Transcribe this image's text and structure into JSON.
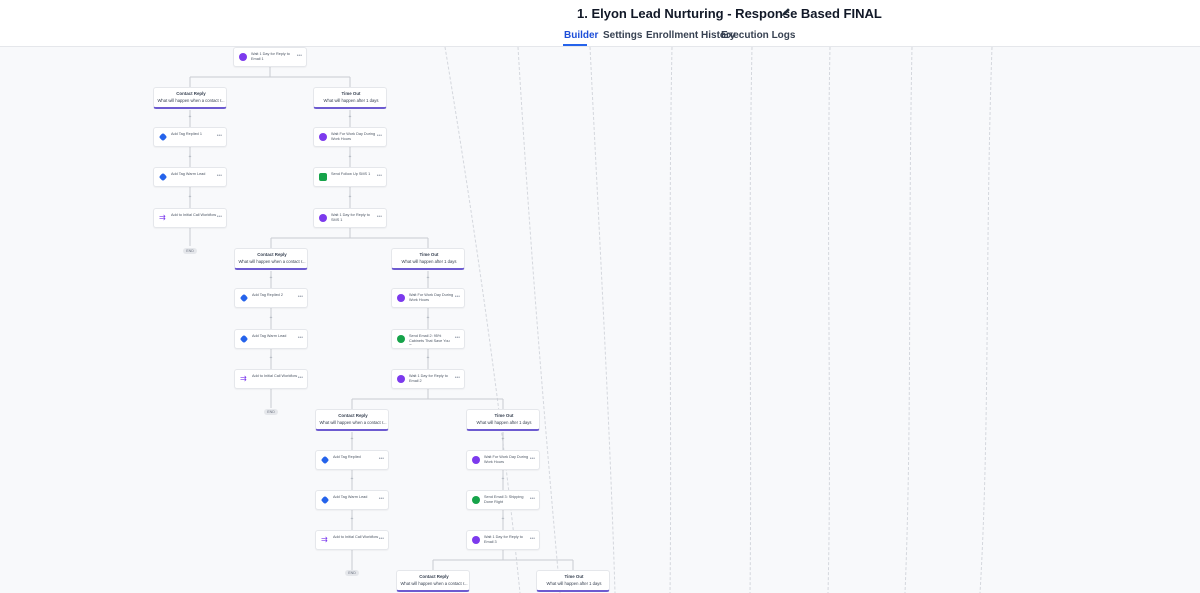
{
  "header": {
    "title": "1. Elyon Lead Nurturing - Response Based FINAL"
  },
  "tabs": [
    {
      "label": "Builder",
      "active": true
    },
    {
      "label": "Settings"
    },
    {
      "label": "Enrollment History"
    },
    {
      "label": "Execution Logs"
    }
  ],
  "workflow": {
    "top_node": "Wait 1 Day for Reply to Email 1",
    "branch_contact_title": "Contact Reply",
    "branch_contact_sub": "What will happen when a contact r...",
    "branch_timeout_title": "Time Out",
    "branch_timeout_sub": "What will happen after 1 days",
    "end_label": "END",
    "group1": {
      "contact": [
        "Add Tag Replied 1",
        "Add Tag Warm Lead",
        "Add to Initial Call Workflow"
      ],
      "timeout": [
        "Wait For Work Day During Work Hours",
        "Send Follow Up SMS 1",
        "Wait 1 Day for Reply to SMS 1"
      ]
    },
    "group2": {
      "contact": [
        "Add Tag Replied 2",
        "Add Tag Warm Lead",
        "Add to Initial Call Workflow"
      ],
      "timeout": [
        "Wait For Work Day During Work Hours",
        "Send Email 2: 95% Cabinets That Save You Time",
        "Wait 1 Day for Reply to Email 2"
      ]
    },
    "group3": {
      "contact": [
        "Add Tag Replied",
        "Add Tag Warm Lead",
        "Add to Initial Call Workflow"
      ],
      "timeout": [
        "Wait For Work Day During Work Hours",
        "Send Email 3: Shipping Done Right",
        "Wait 1 Day for Reply to Email 3"
      ]
    }
  },
  "colors": {
    "accent": "#2563eb",
    "wait": "#7c3aed",
    "tag": "#2563eb",
    "message": "#16a34a",
    "branch_underline": "#6d5bd0"
  }
}
